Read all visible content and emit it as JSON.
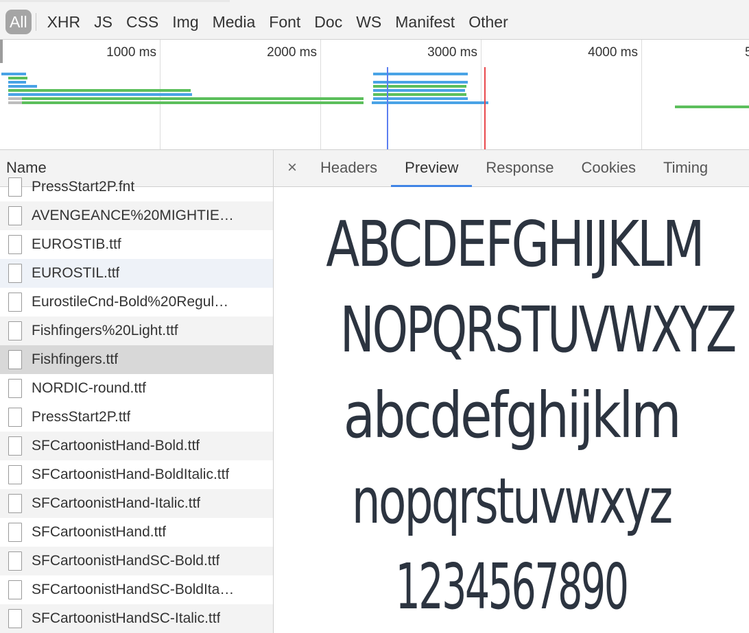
{
  "filters": {
    "items": [
      "All",
      "XHR",
      "JS",
      "CSS",
      "Img",
      "Media",
      "Font",
      "Doc",
      "WS",
      "Manifest",
      "Other"
    ],
    "active": "All"
  },
  "timeline": {
    "ticks": [
      "1000 ms",
      "2000 ms",
      "3000 ms",
      "4000 ms",
      "5"
    ]
  },
  "name_pane": {
    "header": "Name",
    "files": [
      "PressStart2P.fnt",
      "AVENGEANCE%20MIGHTIE…",
      "EUROSTIB.ttf",
      "EUROSTIL.ttf",
      "EurostileCnd-Bold%20Regul…",
      "Fishfingers%20Light.ttf",
      "Fishfingers.ttf",
      "NORDIC-round.ttf",
      "PressStart2P.ttf",
      "SFCartoonistHand-Bold.ttf",
      "SFCartoonistHand-BoldItalic.ttf",
      "SFCartoonistHand-Italic.ttf",
      "SFCartoonistHand.ttf",
      "SFCartoonistHandSC-Bold.ttf",
      "SFCartoonistHandSC-BoldIta…",
      "SFCartoonistHandSC-Italic.ttf"
    ],
    "selected": "Fishfingers.ttf",
    "hovered": "EUROSTIL.ttf"
  },
  "detail": {
    "close_glyph": "×",
    "tabs": [
      "Headers",
      "Preview",
      "Response",
      "Cookies",
      "Timing"
    ],
    "active_tab": "Preview"
  },
  "preview": {
    "lines": [
      "ABCDEFGHIJKLM",
      "NOPQRSTUVWXYZ",
      "abcdefghijklm",
      "nopqrstuvwxyz",
      "1234567890"
    ]
  },
  "colors": {
    "accent": "#3f84e5",
    "waterfall_green": "#5cbf5c",
    "waterfall_blue": "#4aa3e6",
    "dom_content_line": "#5b7ef0",
    "load_line": "#e9484c",
    "glyph_color": "#2c3440"
  }
}
